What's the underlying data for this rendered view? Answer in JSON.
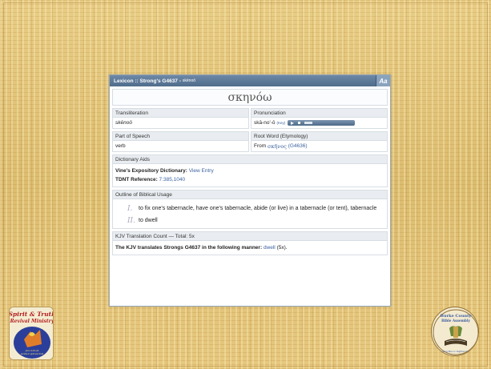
{
  "lexicon": {
    "title": "Lexicon :: Strong's G4637 -",
    "title_translit": "skēnoō",
    "font_button": "Aa",
    "greek_word": "σκηνόω",
    "transliteration": {
      "label": "Transliteration",
      "value": "skēnoō"
    },
    "pronunciation": {
      "label": "Pronunciation",
      "value": "skā-no'-ō",
      "key": "(Key)"
    },
    "part_of_speech": {
      "label": "Part of Speech",
      "value": "verb"
    },
    "root_word": {
      "label": "Root Word (Etymology)",
      "prefix": "From",
      "greek": "σκῆνος",
      "ref": "(G4636)"
    },
    "dictionary_aids": {
      "label": "Dictionary Aids",
      "vines_label": "Vine's Expository Dictionary:",
      "vines_link": "View Entry",
      "tdnt_label": "TDNT Reference:",
      "tdnt_value": "7:385,1040"
    },
    "outline": {
      "label": "Outline of Biblical Usage",
      "items": [
        {
          "numeral": "I.",
          "text": "to fix one's tabernacle, have one's tabernacle, abide (or live) in a tabernacle (or tent), tabernacle"
        },
        {
          "numeral": "II.",
          "text": "to dwell"
        }
      ]
    },
    "kjv": {
      "label": "KJV Translation Count — Total: 5x",
      "text_bold": "The KJV translates Strongs G4637 in the following manner:",
      "word": "dwell",
      "count": "(5x)."
    }
  },
  "logos": {
    "left": "Spirit & Truth Revival Ministry",
    "right": "Burke County Bible Assembly"
  },
  "colors": {
    "titlebar": "#5b7898",
    "link": "#3a62a0",
    "slide_bg": "#e2c57a"
  }
}
